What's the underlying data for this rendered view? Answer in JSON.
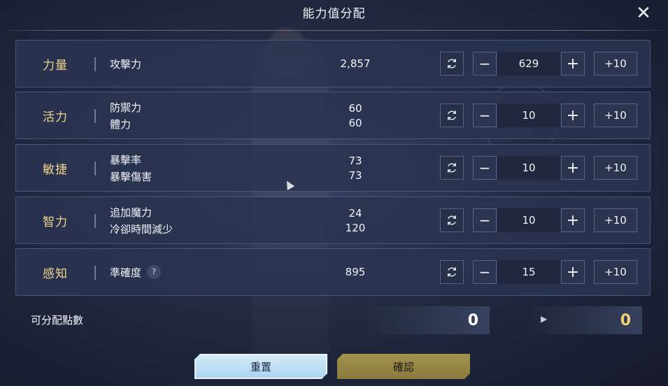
{
  "title": "能力值分配",
  "rows": [
    {
      "attribute": "力量",
      "stats": [
        "攻擊力"
      ],
      "values": [
        "2,857"
      ],
      "count": "629",
      "add_label": "+10"
    },
    {
      "attribute": "活力",
      "stats": [
        "防禦力",
        "體力"
      ],
      "values": [
        "60",
        "60"
      ],
      "count": "10",
      "add_label": "+10"
    },
    {
      "attribute": "敏捷",
      "stats": [
        "暴擊率",
        "暴擊傷害"
      ],
      "values": [
        "73",
        "73"
      ],
      "count": "10",
      "add_label": "+10"
    },
    {
      "attribute": "智力",
      "stats": [
        "追加魔力",
        "冷卻時間減少"
      ],
      "values": [
        "24",
        "120"
      ],
      "count": "10",
      "add_label": "+10"
    },
    {
      "attribute": "感知",
      "stats": [
        "準確度"
      ],
      "values": [
        "895"
      ],
      "count": "15",
      "add_label": "+10",
      "help": "?"
    }
  ],
  "distributable": {
    "label": "可分配點數",
    "current": "0",
    "after": "0"
  },
  "buttons": {
    "reset": "重置",
    "confirm": "確認"
  },
  "icons": {
    "close": "close-icon",
    "reset": "refresh-icon",
    "minus": "minus-icon",
    "plus": "plus-icon",
    "arrow": "arrow-right-icon"
  },
  "colors": {
    "attribute_label": "#f0d48e",
    "points_after": "#f3d272",
    "reset_button": "#a9d3f0",
    "confirm_button": "#8a7b3e"
  }
}
